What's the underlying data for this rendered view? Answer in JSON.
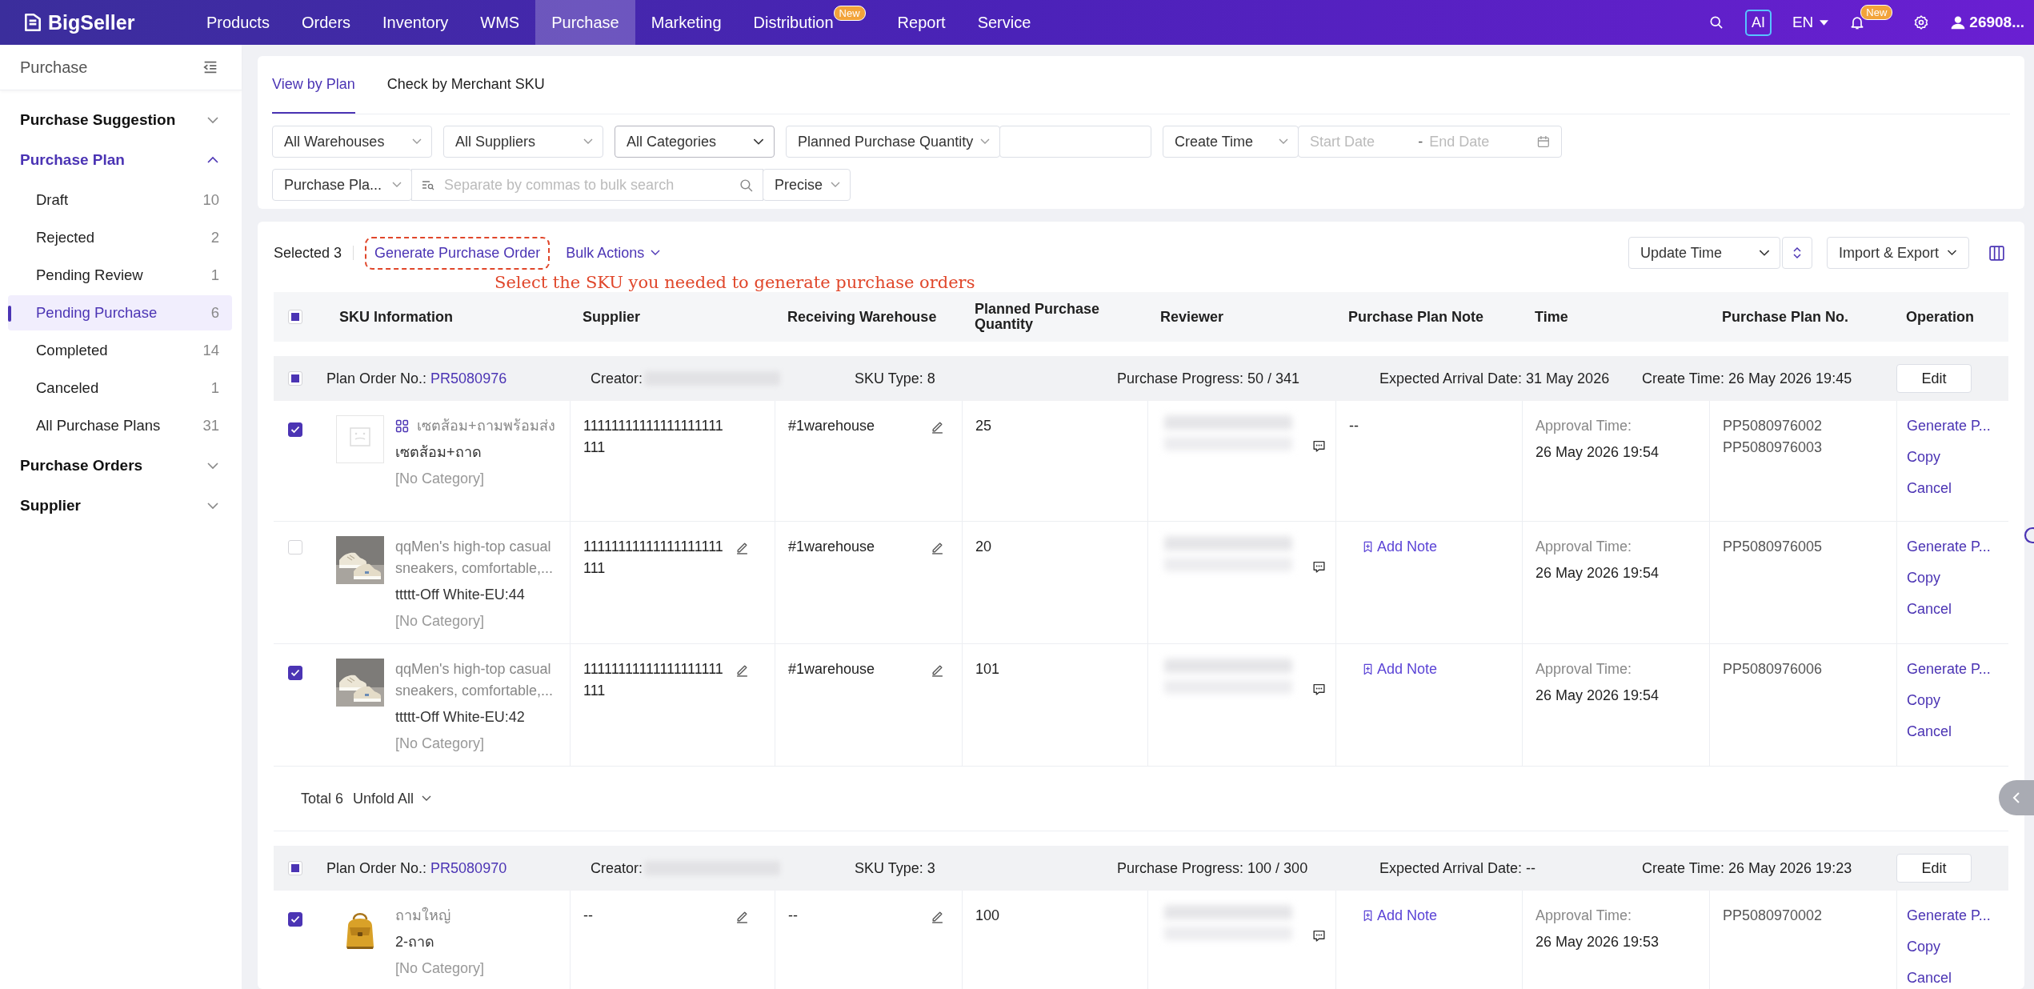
{
  "top_nav": {
    "logo": "BigSeller",
    "items": [
      {
        "label": "Products",
        "selected": false
      },
      {
        "label": "Orders",
        "selected": false
      },
      {
        "label": "Inventory",
        "selected": false
      },
      {
        "label": "WMS",
        "selected": false
      },
      {
        "label": "Purchase",
        "selected": true
      },
      {
        "label": "Marketing",
        "selected": false
      },
      {
        "label": "Distribution",
        "selected": false,
        "badge": "New"
      },
      {
        "label": "Report",
        "selected": false
      },
      {
        "label": "Service",
        "selected": false
      }
    ],
    "ai": "AI",
    "language": "EN",
    "notification_badge": "New",
    "user": "26908..."
  },
  "sidebar": {
    "title": "Purchase",
    "sections": [
      {
        "label": "Purchase Suggestion",
        "expanded": false,
        "selected": false
      },
      {
        "label": "Purchase Plan",
        "expanded": true,
        "selected": true,
        "children": [
          {
            "label": "Draft",
            "count": "10",
            "selected": false
          },
          {
            "label": "Rejected",
            "count": "2",
            "selected": false
          },
          {
            "label": "Pending Review",
            "count": "1",
            "selected": false
          },
          {
            "label": "Pending Purchase",
            "count": "6",
            "selected": true
          },
          {
            "label": "Completed",
            "count": "14",
            "selected": false
          },
          {
            "label": "Canceled",
            "count": "1",
            "selected": false
          },
          {
            "label": "All Purchase Plans",
            "count": "31",
            "selected": false
          }
        ]
      },
      {
        "label": "Purchase Orders",
        "expanded": false,
        "selected": false
      },
      {
        "label": "Supplier",
        "expanded": false,
        "selected": false
      }
    ]
  },
  "view_tabs": [
    {
      "label": "View by Plan",
      "selected": true
    },
    {
      "label": "Check by Merchant SKU",
      "selected": false
    }
  ],
  "filters": {
    "warehouse": "All Warehouses",
    "supplier": "All Suppliers",
    "category": "All Categories",
    "quantity_type": "Planned Purchase Quantity",
    "time_type": "Create Time",
    "start_placeholder": "Start Date",
    "range_separator": "-",
    "end_placeholder": "End Date",
    "search_type": "Purchase Pla...",
    "search_placeholder": "Separate by commas to bulk search",
    "match_mode": "Precise"
  },
  "toolbar": {
    "selected_count": "Selected 3",
    "generate": "Generate Purchase Order",
    "bulk": "Bulk Actions",
    "hint": "Select the SKU you needed to generate purchase orders",
    "sort": "Update Time",
    "import_export": "Import & Export"
  },
  "table": {
    "header_indeterminate": true,
    "columns": [
      "SKU Information",
      "Supplier",
      "Receiving Warehouse",
      "Planned Purchase Quantity",
      "Reviewer",
      "Purchase Plan Note",
      "Time",
      "Purchase Plan No.",
      "Operation"
    ],
    "groups": [
      {
        "indeterminate": true,
        "plan_label": "Plan Order No.:",
        "plan_no": "PR5080976",
        "creator_label": "Creator:",
        "sku_type": "SKU Type: 8",
        "progress": "Purchase Progress: 50 / 341",
        "arrival": "Expected Arrival Date: 31 May 2026",
        "create_time": "Create Time: 26 May 2026 19:45",
        "edit": "Edit",
        "rows": [
          {
            "checked": true,
            "has_image": false,
            "combo": true,
            "title": "เซตส้อม+ถามพร้อมส่ง",
            "variant": "เซตส้อม+ถาด",
            "category": "[No Category]",
            "supplier": "11111111111111111111111",
            "supplier_editable": false,
            "warehouse": "#1warehouse",
            "quantity": "25",
            "note": {
              "kind": "text",
              "text": "--"
            },
            "approval_label": "Approval Time:",
            "approval_time": "26 May 2026 19:54",
            "plan_nos": [
              "PP5080976002",
              "PP5080976003"
            ],
            "actions": [
              "Generate P...",
              "Copy",
              "Cancel"
            ]
          },
          {
            "checked": false,
            "has_image": true,
            "combo": false,
            "title": "qqMen's high-top casual sneakers, comfortable,...",
            "variant": "ttttt-Off White-EU:44",
            "category": "[No Category]",
            "supplier": "11111111111111111111111",
            "supplier_editable": true,
            "warehouse": "#1warehouse",
            "quantity": "20",
            "note": {
              "kind": "add",
              "text": "Add Note"
            },
            "approval_label": "Approval Time:",
            "approval_time": "26 May 2026 19:54",
            "plan_nos": [
              "PP5080976005"
            ],
            "actions": [
              "Generate P...",
              "Copy",
              "Cancel"
            ]
          },
          {
            "checked": true,
            "has_image": true,
            "combo": false,
            "title": "qqMen's high-top casual sneakers, comfortable,...",
            "variant": "ttttt-Off White-EU:42",
            "category": "[No Category]",
            "supplier": "11111111111111111111111",
            "supplier_editable": true,
            "warehouse": "#1warehouse",
            "quantity": "101",
            "note": {
              "kind": "add",
              "text": "Add Note"
            },
            "approval_label": "Approval Time:",
            "approval_time": "26 May 2026 19:54",
            "plan_nos": [
              "PP5080976006"
            ],
            "actions": [
              "Generate P...",
              "Copy",
              "Cancel"
            ]
          }
        ],
        "footer": {
          "total": "Total 6",
          "unfold": "Unfold All"
        }
      },
      {
        "indeterminate": true,
        "plan_label": "Plan Order No.:",
        "plan_no": "PR5080970",
        "creator_label": "Creator:",
        "sku_type": "SKU Type: 3",
        "progress": "Purchase Progress: 100 / 300",
        "arrival": "Expected Arrival Date: --",
        "create_time": "Create Time: 26 May 2026 19:23",
        "edit": "Edit",
        "rows": [
          {
            "checked": true,
            "has_image": true,
            "combo": false,
            "title": "ถามใหญ่",
            "variant": "2-ถาด",
            "category": "[No Category]",
            "supplier": "--",
            "supplier_editable": true,
            "warehouse": "--",
            "quantity": "100",
            "note": {
              "kind": "add",
              "text": "Add Note"
            },
            "approval_label": "Approval Time:",
            "approval_time": "26 May 2026 19:53",
            "plan_nos": [
              "PP5080970002"
            ],
            "actions": [
              "Generate P...",
              "Copy",
              "Cancel"
            ]
          }
        ]
      }
    ]
  }
}
